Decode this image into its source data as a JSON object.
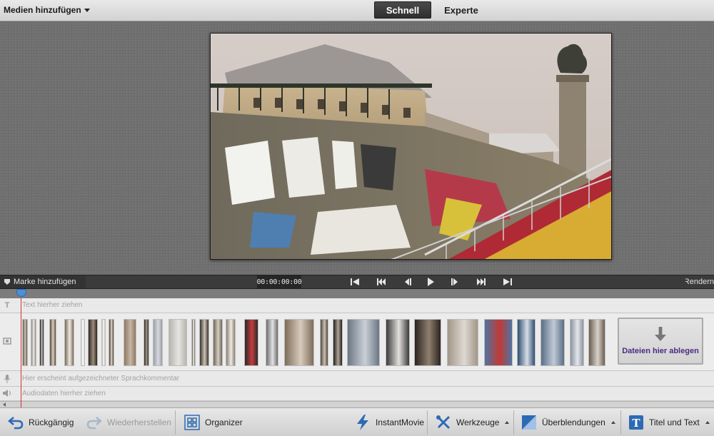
{
  "topbar": {
    "media_add_label": "Medien hinzufügen",
    "mode_tabs": [
      "Schnell",
      "Experte"
    ],
    "active_mode": "Schnell"
  },
  "transport": {
    "marker_label": "Marke hinzufügen",
    "timecode": "00:00:00:00",
    "render_label": "Rendern"
  },
  "timeline": {
    "text_track_label": "Text hierher ziehen",
    "voice_track_label": "Hier erscheint aufgezeichneter Sprachkommentar",
    "audio_track_label": "Audiodaten hierher ziehen",
    "drop_zone_label": "Dateien hier ablegen"
  },
  "toolbar": {
    "undo_label": "Rückgängig",
    "redo_label": "Wiederherstellen",
    "organizer_label": "Organizer",
    "instantmovie_label": "InstantMovie",
    "tools_label": "Werkzeuge",
    "transitions_label": "Überblendungen",
    "titles_label": "Titel und Text"
  },
  "colors": {
    "accent": "#4b8fd8",
    "playhead": "#d23232",
    "drop_label": "#4b2b82",
    "active_tab_bg": "#333333"
  }
}
